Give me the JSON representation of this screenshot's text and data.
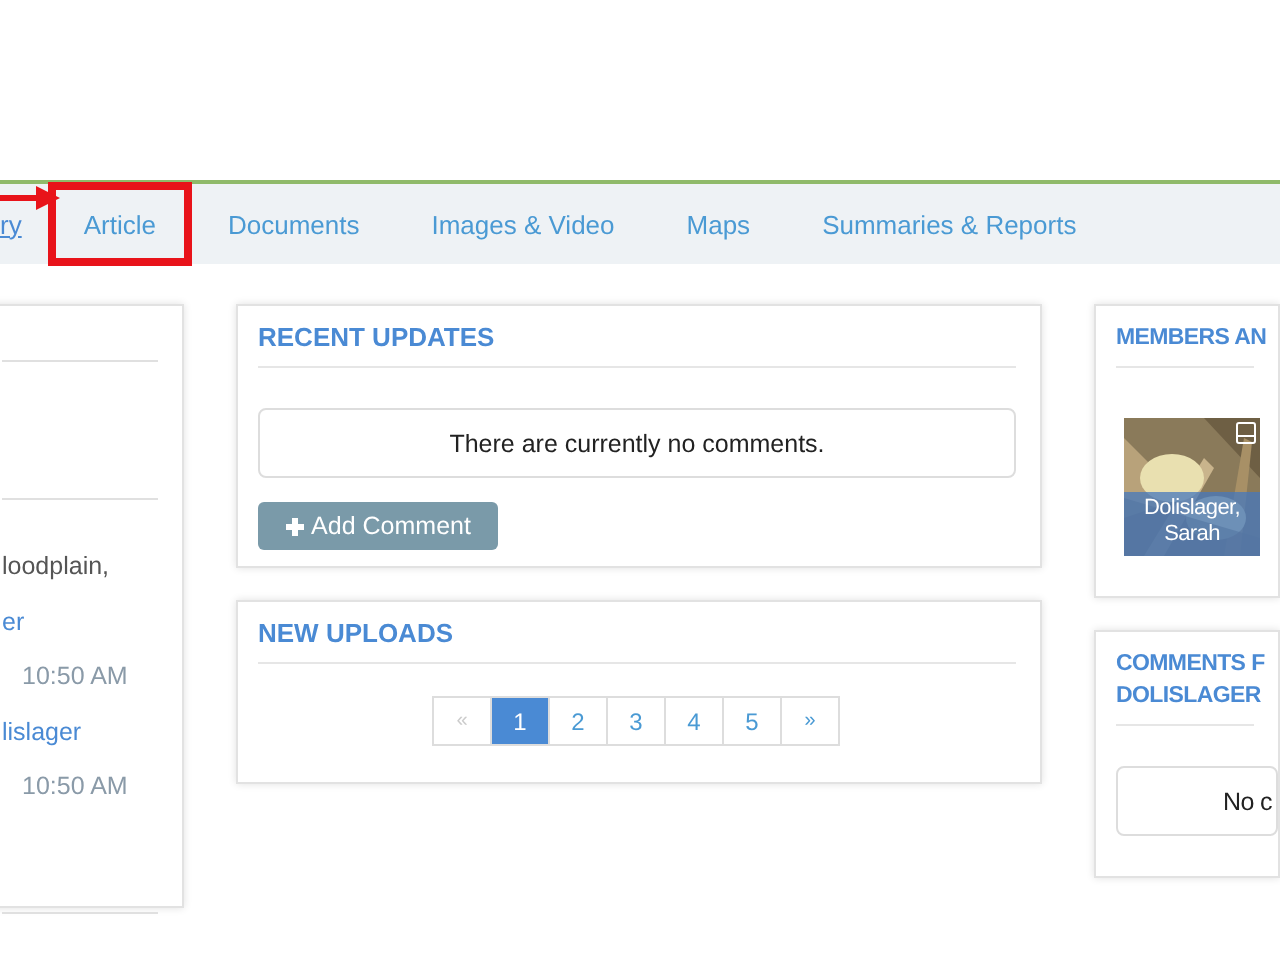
{
  "nav": {
    "partial_link": "ry",
    "tabs": [
      {
        "label": "Article",
        "selected": true
      },
      {
        "label": "Documents",
        "selected": false
      },
      {
        "label": "Images & Video",
        "selected": false
      },
      {
        "label": "Maps",
        "selected": false
      },
      {
        "label": "Summaries & Reports",
        "selected": false
      }
    ]
  },
  "left_panel": {
    "lines": [
      {
        "kind": "text",
        "text": "loodplain,"
      },
      {
        "kind": "link",
        "text": "er"
      },
      {
        "kind": "time",
        "text": "10:50 AM"
      },
      {
        "kind": "link",
        "text": "lislager"
      },
      {
        "kind": "time",
        "text": "10:50 AM"
      }
    ]
  },
  "recent_updates": {
    "title": "RECENT UPDATES",
    "message": "There are currently no comments.",
    "button": "Add Comment"
  },
  "new_uploads": {
    "title": "NEW UPLOADS",
    "pages": [
      {
        "label": "«",
        "kind": "prev",
        "disabled": true,
        "selected": false
      },
      {
        "label": "1",
        "kind": "page",
        "disabled": false,
        "selected": true
      },
      {
        "label": "2",
        "kind": "page",
        "disabled": false,
        "selected": false
      },
      {
        "label": "3",
        "kind": "page",
        "disabled": false,
        "selected": false
      },
      {
        "label": "4",
        "kind": "page",
        "disabled": false,
        "selected": false
      },
      {
        "label": "5",
        "kind": "page",
        "disabled": false,
        "selected": false
      },
      {
        "label": "»",
        "kind": "next",
        "disabled": false,
        "selected": false
      }
    ]
  },
  "members": {
    "title": "MEMBERS AN",
    "member": {
      "name": "Dolislager, Sarah",
      "kind": "picture"
    }
  },
  "comments": {
    "title_lines": [
      "COMMENTS F",
      "DOLISLAGER"
    ],
    "message": "No c"
  }
}
